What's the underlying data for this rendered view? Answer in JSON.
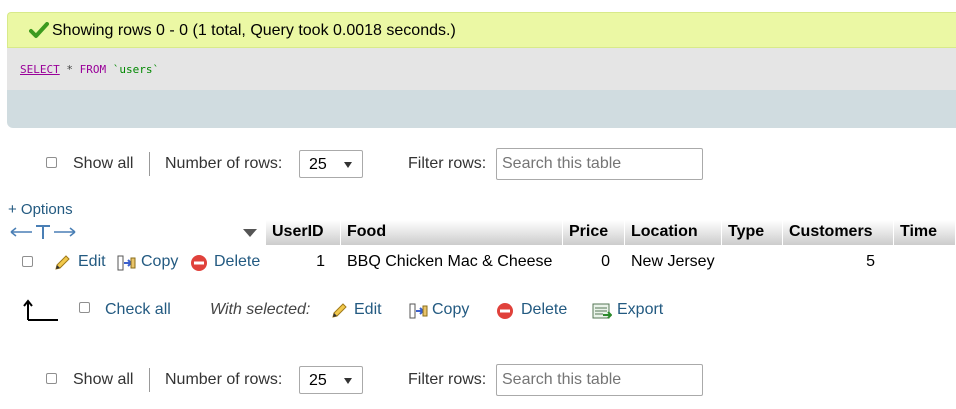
{
  "message": {
    "text": "Showing rows 0 - 0 (1 total, Query took 0.0018 seconds.)",
    "icon": "check-icon",
    "color": "#ebf8a4"
  },
  "sql": {
    "select_kw": "SELECT",
    "star": " * ",
    "from_kw": "FROM",
    "table": " `users`"
  },
  "nav_top": {
    "show_all": "Show all",
    "rows_label": "Number of rows:",
    "rows_value": "25",
    "filter_label": "Filter rows:",
    "filter_placeholder": "Search this table"
  },
  "nav_bottom": {
    "show_all": "Show all",
    "rows_label": "Number of rows:",
    "rows_value": "25",
    "filter_label": "Filter rows:",
    "filter_placeholder": "Search this table"
  },
  "options_link": "+ Options",
  "columns": [
    "UserID",
    "Food",
    "Price",
    "Location",
    "Type",
    "Customers",
    "Time"
  ],
  "row_actions": {
    "edit": "Edit",
    "copy": "Copy",
    "delete": "Delete"
  },
  "rows": [
    {
      "UserID": "1",
      "Food": "BBQ Chicken Mac & Cheese",
      "Price": "0",
      "Location": "New Jersey",
      "Type": "",
      "Customers": "5",
      "Time": ""
    }
  ],
  "bulk": {
    "check_all": "Check all",
    "with_selected": "With selected:",
    "edit": "Edit",
    "copy": "Copy",
    "delete": "Delete",
    "export": "Export"
  },
  "colors": {
    "link": "#235a81",
    "delete": "#e0413b",
    "sql_keyword": "#990099"
  }
}
